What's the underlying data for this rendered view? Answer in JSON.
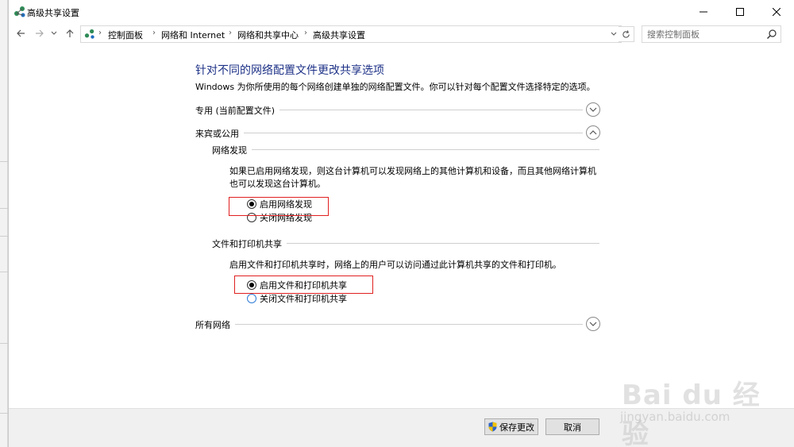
{
  "window": {
    "title": "高级共享设置"
  },
  "address_bar": {
    "breadcrumbs": [
      "控制面板",
      "网络和 Internet",
      "网络和共享中心",
      "高级共享设置"
    ]
  },
  "search": {
    "placeholder": "搜索控制面板"
  },
  "main": {
    "heading": "针对不同的网络配置文件更改共享选项",
    "description": "Windows 为你所使用的每个网络创建单独的网络配置文件。你可以针对每个配置文件选择特定的选项。",
    "profiles": [
      {
        "label": "专用 (当前配置文件)",
        "expanded": false
      },
      {
        "label": "来宾或公用",
        "expanded": true
      },
      {
        "label": "所有网络",
        "expanded": false
      }
    ],
    "network_discovery": {
      "title": "网络发现",
      "text": "如果已启用网络发现，则这台计算机可以发现网络上的其他计算机和设备，而且其他网络计算机也可以发现这台计算机。",
      "options": [
        {
          "label": "启用网络发现",
          "selected": true
        },
        {
          "label": "关闭网络发现",
          "selected": false
        }
      ]
    },
    "file_printer_sharing": {
      "title": "文件和打印机共享",
      "text": "启用文件和打印机共享时，网络上的用户可以访问通过此计算机共享的文件和打印机。",
      "options": [
        {
          "label": "启用文件和打印机共享",
          "selected": true
        },
        {
          "label": "关闭文件和打印机共享",
          "selected": false
        }
      ]
    }
  },
  "footer": {
    "save_label": "保存更改",
    "cancel_label": "取消"
  },
  "watermark": {
    "logo": "Bai du 经验",
    "url": "jingyan.baidu.com"
  },
  "colors": {
    "heading": "#1e3287",
    "highlight_box": "#e02020"
  }
}
